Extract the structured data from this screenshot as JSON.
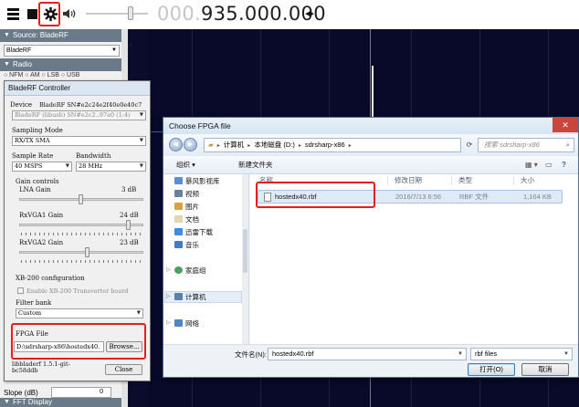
{
  "toolbar": {
    "frequency_dim": "000.",
    "frequency_lit": "935.000.000",
    "tune_arrows": "◂▸"
  },
  "left_panel": {
    "source_header": "Source: BladeRF",
    "source_value": "BladeRF",
    "radio_header": "Radio",
    "radio_modes": "○ NFM  ○ AM  ○ LSB  ○ USB",
    "slope_label": "Slope (dB)",
    "slope_value": "0",
    "fft_header": "FFT Display"
  },
  "bladerf": {
    "title": "BladeRF Controller",
    "device_label": "Device",
    "device_value": "BladeRF SN#e2c24e2f40e0e40c7",
    "device_info": "BladeRF (libusb) SN#e2c2..97a0 (1:4)",
    "sampling_mode_label": "Sampling Mode",
    "sampling_mode_value": "RX/TX SMA",
    "sample_rate_label": "Sample Rate",
    "sample_rate_value": "40 MSPS",
    "bandwidth_label": "Bandwidth",
    "bandwidth_value": "28 MHz",
    "gain_controls_label": "Gain controls",
    "lna_label": "LNA Gain",
    "lna_value": "3 dB",
    "lna_level": 0.5,
    "rxvga1_label": "RxVGA1 Gain",
    "rxvga1_value": "24 dB",
    "rxvga1_level": 0.9,
    "rxvga2_label": "RxVGA2 Gain",
    "rxvga2_value": "23 dB",
    "rxvga2_level": 0.55,
    "xb200_label": "XB-200 configuration",
    "xb200_enable_label": "Enable XB-200 Transverter board",
    "filter_bank_label": "Filter bank",
    "filter_bank_value": "Custom",
    "fpga_label": "FPGA File",
    "fpga_path": "D:\\sdrsharp-x86\\hostedx40.",
    "browse_label": "Browse...",
    "libver": "libbladerf 1.5.1-git-\nbc58ddb",
    "close_label": "Close"
  },
  "dialog": {
    "title": "Choose FPGA file",
    "close_glyph": "✕",
    "path": [
      "计算机",
      "本地磁盘 (D:)",
      "sdrsharp-x86"
    ],
    "search_placeholder": "搜索 sdrsharp-x86",
    "cmd_organize": "组织 ▾",
    "cmd_new_folder": "新建文件夹",
    "nav": {
      "favorites": "暴风影视库",
      "videos": "视频",
      "pictures": "图片",
      "documents": "文档",
      "downloads": "迅雷下载",
      "music": "音乐",
      "homegroup": "家庭组",
      "computer": "计算机",
      "network": "网络"
    },
    "columns": {
      "name": "名称",
      "modified": "修改日期",
      "type": "类型",
      "size": "大小"
    },
    "file": {
      "name": "hostedx40.rbf",
      "modified": "2016/7/13 6:56",
      "type": "RBF 文件",
      "size": "1,164 KB"
    },
    "filename_label": "文件名(N):",
    "filename_value": "hostedx40.rbf",
    "filetype_value": "rbf files",
    "open_label": "打开(O)",
    "cancel_label": "取消"
  },
  "colors": {
    "highlight": "#e5201b",
    "spectrum_bg": "#09092a",
    "panel_header": "#6b7a88"
  }
}
